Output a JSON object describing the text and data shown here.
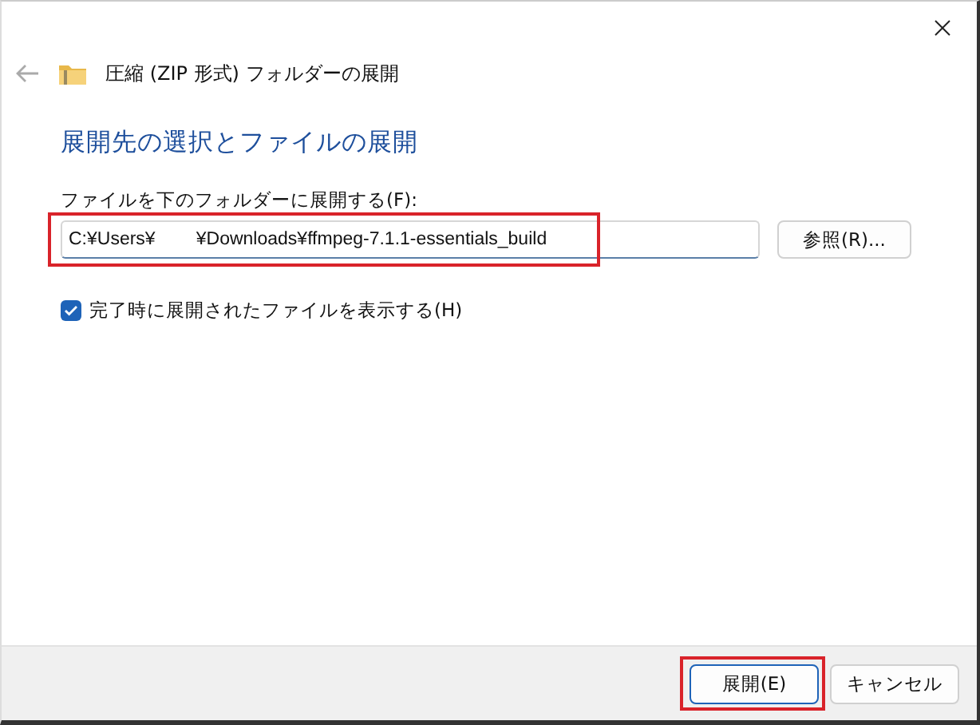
{
  "window": {
    "title": "圧縮 (ZIP 形式) フォルダーの展開"
  },
  "heading": "展開先の選択とファイルの展開",
  "destination": {
    "label": "ファイルを下のフォルダーに展開する(F):",
    "value": "C:¥Users¥        ¥Downloads¥ffmpeg-7.1.1-essentials_build",
    "highlighted": true
  },
  "browse_button": "参照(R)...",
  "show_files": {
    "label": "完了時に展開されたファイルを表示する(H)",
    "checked": true
  },
  "buttons": [
    {
      "label": "展開(E)",
      "kind": "primary",
      "highlighted": true
    },
    {
      "label": "キャンセル",
      "kind": "secondary",
      "highlighted": false
    }
  ]
}
